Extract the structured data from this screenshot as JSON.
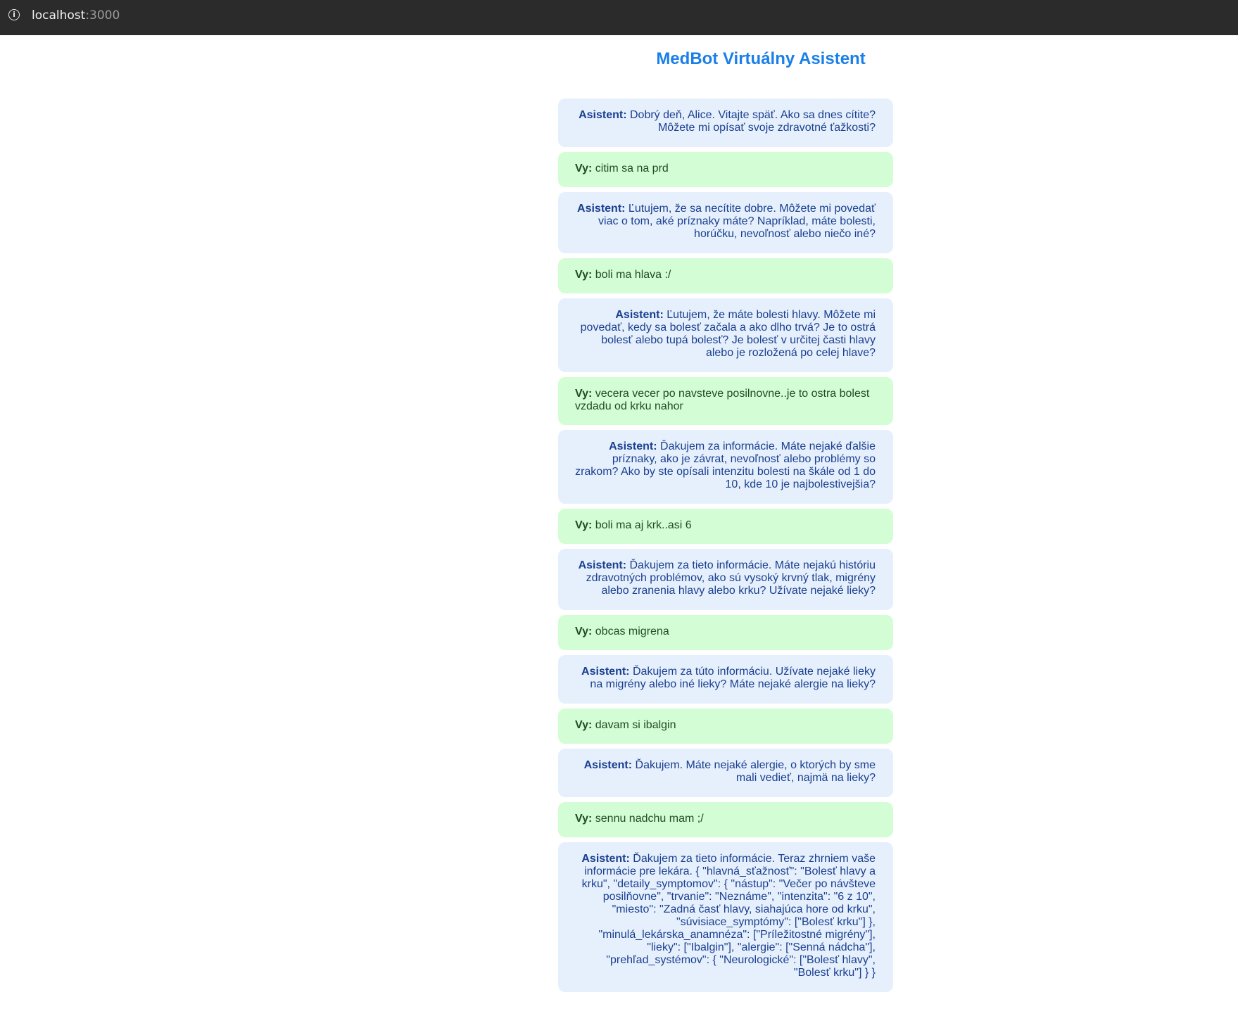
{
  "browser": {
    "host": "localhost",
    "port": ":3000"
  },
  "title": "MedBot Virtuálny Asistent",
  "speakers": {
    "assistant": "Asistent:",
    "user": "Vy:"
  },
  "messages": [
    {
      "role": "assistant",
      "text": "Dobrý deň, Alice. Vitajte späť. Ako sa dnes cítite? Môžete mi opísať svoje zdravotné ťažkosti?"
    },
    {
      "role": "user",
      "text": "citim sa na prd"
    },
    {
      "role": "assistant",
      "text": "Ľutujem, že sa necítite dobre. Môžete mi povedať viac o tom, aké príznaky máte? Napríklad, máte bolesti, horúčku, nevoľnosť alebo niečo iné?"
    },
    {
      "role": "user",
      "text": "boli ma hlava :/"
    },
    {
      "role": "assistant",
      "text": "Ľutujem, že máte bolesti hlavy. Môžete mi povedať, kedy sa bolesť začala a ako dlho trvá? Je to ostrá bolesť alebo tupá bolesť? Je bolesť v určitej časti hlavy alebo je rozložená po celej hlave?"
    },
    {
      "role": "user",
      "text": "vecera vecer po navsteve posilnovne..je to ostra bolest vzdadu od krku nahor"
    },
    {
      "role": "assistant",
      "text": "Ďakujem za informácie. Máte nejaké ďalšie príznaky, ako je závrat, nevoľnosť alebo problémy so zrakom? Ako by ste opísali intenzitu bolesti na škále od 1 do 10, kde 10 je najbolestivejšia?"
    },
    {
      "role": "user",
      "text": "boli ma aj krk..asi 6"
    },
    {
      "role": "assistant",
      "text": "Ďakujem za tieto informácie. Máte nejakú históriu zdravotných problémov, ako sú vysoký krvný tlak, migrény alebo zranenia hlavy alebo krku? Užívate nejaké lieky?"
    },
    {
      "role": "user",
      "text": "obcas migrena"
    },
    {
      "role": "assistant",
      "text": "Ďakujem za túto informáciu. Užívate nejaké lieky na migrény alebo iné lieky? Máte nejaké alergie na lieky?"
    },
    {
      "role": "user",
      "text": "davam si ibalgin"
    },
    {
      "role": "assistant",
      "text": "Ďakujem. Máte nejaké alergie, o ktorých by sme mali vedieť, najmä na lieky?"
    },
    {
      "role": "user",
      "text": "sennu nadchu mam ;/"
    },
    {
      "role": "assistant",
      "text": "Ďakujem za tieto informácie. Teraz zhrniem vaše informácie pre lekára. { \"hlavná_sťažnosť\": \"Bolesť hlavy a krku\", \"detaily_symptomov\": { \"nástup\": \"Večer po návšteve posilňovne\", \"trvanie\": \"Neznáme\", \"intenzita\": \"6 z 10\", \"miesto\": \"Zadná časť hlavy, siahajúca hore od krku\", \"súvisiace_symptómy\": [\"Bolesť krku\"] }, \"minulá_lekárska_anamnéza\": [\"Príležitostné migrény\"], \"lieky\": [\"Ibalgin\"], \"alergie\": [\"Senná nádcha\"], \"prehľad_systémov\": { \"Neurologické\": [\"Bolesť hlavy\", \"Bolesť krku\"] } }"
    }
  ]
}
